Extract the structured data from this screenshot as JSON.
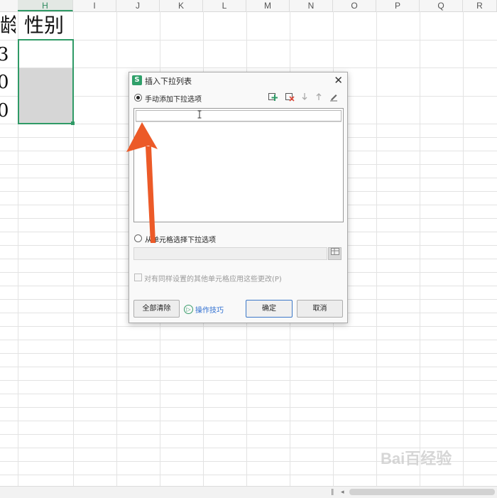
{
  "sheet": {
    "columns": [
      "H",
      "I",
      "J",
      "K",
      "L",
      "M",
      "N",
      "O",
      "P",
      "Q",
      "R"
    ],
    "active_column": "H",
    "partial_header_text": "龄",
    "header_cell_text": "性别",
    "partial_left_digits": [
      "3",
      "0",
      "0"
    ]
  },
  "dialog": {
    "title": "插入下拉列表",
    "close_label": "✕",
    "option_manual": "手动添加下拉选项",
    "option_range": "从单元格选择下拉选项",
    "list_input_value": "",
    "apply_checkbox_label": "对有同样设置的其他单元格应用这些更改(P)",
    "btn_clear_all": "全部清除",
    "link_tips": "操作技巧",
    "btn_ok": "确定",
    "btn_cancel": "取消",
    "icons": [
      "add-item-icon",
      "delete-item-icon",
      "move-down-icon",
      "move-up-icon",
      "edit-icon"
    ]
  },
  "watermark": "Bai百经验",
  "colors": {
    "accent_green": "#2f9a66",
    "arrow_orange": "#ec5a28",
    "link_blue": "#2f6fd1"
  }
}
